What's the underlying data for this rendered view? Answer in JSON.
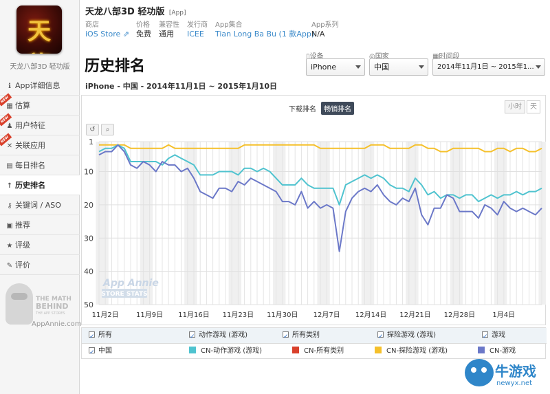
{
  "app": {
    "icon_text": "天龍",
    "subname": "天龙八部3D 轻功版",
    "title": "天龙八部3D 轻功版",
    "tag": "[App]"
  },
  "meta": [
    {
      "key": "商店",
      "value": "iOS Store  ⇗"
    },
    {
      "key": "价格",
      "value": "免费"
    },
    {
      "key": "兼容性",
      "value": "通用"
    },
    {
      "key": "发行商",
      "value": "ICEE"
    },
    {
      "key": "App集合",
      "value": "Tian Long Ba Bu (1 款App)"
    },
    {
      "key": "App系列",
      "value": "N/A"
    }
  ],
  "sidebar": {
    "items": [
      {
        "icon": "info-icon",
        "glyph": "ℹ",
        "label": "App详细信息",
        "badge": ""
      },
      {
        "icon": "calculator-icon",
        "glyph": "▦",
        "label": "估算",
        "badge": "NEW"
      },
      {
        "icon": "user-icon",
        "glyph": "♟",
        "label": "用户特征",
        "badge": "NEW"
      },
      {
        "icon": "link-icon",
        "glyph": "✕",
        "label": "关联应用",
        "badge": "NEW"
      },
      {
        "icon": "calendar-icon",
        "glyph": "▤",
        "label": "每日排名",
        "badge": ""
      },
      {
        "icon": "arrow-up-icon",
        "glyph": "↑",
        "label": "历史排名",
        "badge": ""
      },
      {
        "icon": "key-icon",
        "glyph": "⚷",
        "label": "关键词 / ASO",
        "badge": ""
      },
      {
        "icon": "feature-icon",
        "glyph": "▣",
        "label": "推荐",
        "badge": ""
      },
      {
        "icon": "star-icon",
        "glyph": "★",
        "label": "评级",
        "badge": ""
      },
      {
        "icon": "comment-icon",
        "glyph": "✎",
        "label": "评价",
        "badge": ""
      }
    ],
    "active_index": 5,
    "promo": {
      "line1": "THE MATH",
      "line2": "BEHIND",
      "line3": "THE APP STORES",
      "url": "AppAnnie.com"
    }
  },
  "page": {
    "title": "历史排名",
    "subtitle": "iPhone - 中国 - 2014年11月1日 ~ 2015年1月10日"
  },
  "filters": {
    "device": {
      "label": "设备",
      "value": "iPhone"
    },
    "country": {
      "label": "国家",
      "value": "中国"
    },
    "period": {
      "label": "时间段",
      "value": "2014年11月1日 ~ 2015年1..."
    }
  },
  "chart_controls": {
    "tab_download": "下载排名",
    "tab_grossing": "畅销排名",
    "active_tab": "畅销排名",
    "hour": "小时",
    "day": "天",
    "reset_icon": "↺",
    "zoom_icon": "⌕"
  },
  "watermark": {
    "line1": "App Annie",
    "line2": "STORE STATS"
  },
  "legend": {
    "filters": [
      "所有",
      "动作游戏 (游戏)",
      "所有类别",
      "探险游戏 (游戏)",
      "游戏"
    ],
    "country": "中国",
    "series_labels": [
      "CN-动作游戏 (游戏)",
      "CN-所有类别",
      "CN-探险游戏 (游戏)",
      "CN-游戏"
    ]
  },
  "site_watermark": {
    "line1": "牛游戏",
    "line2": "newyx.net"
  },
  "colors": {
    "action": "#4fc3cf",
    "all": "#d9402b",
    "adventure": "#f5c02a",
    "games": "#6b78c8",
    "weekend_band": "#f0f0f0"
  },
  "chart_data": {
    "type": "line",
    "y_inverted": true,
    "ylim": [
      1,
      50
    ],
    "yticks": [
      1,
      10,
      20,
      30,
      40,
      50
    ],
    "grid": true,
    "x": [
      "2014-11-01",
      "2014-11-02",
      "2014-11-03",
      "2014-11-04",
      "2014-11-05",
      "2014-11-06",
      "2014-11-07",
      "2014-11-08",
      "2014-11-09",
      "2014-11-10",
      "2014-11-11",
      "2014-11-12",
      "2014-11-13",
      "2014-11-14",
      "2014-11-15",
      "2014-11-16",
      "2014-11-17",
      "2014-11-18",
      "2014-11-19",
      "2014-11-20",
      "2014-11-21",
      "2014-11-22",
      "2014-11-23",
      "2014-11-24",
      "2014-11-25",
      "2014-11-26",
      "2014-11-27",
      "2014-11-28",
      "2014-11-29",
      "2014-11-30",
      "2014-12-01",
      "2014-12-02",
      "2014-12-03",
      "2014-12-04",
      "2014-12-05",
      "2014-12-06",
      "2014-12-07",
      "2014-12-08",
      "2014-12-09",
      "2014-12-10",
      "2014-12-11",
      "2014-12-12",
      "2014-12-13",
      "2014-12-14",
      "2014-12-15",
      "2014-12-16",
      "2014-12-17",
      "2014-12-18",
      "2014-12-19",
      "2014-12-20",
      "2014-12-21",
      "2014-12-22",
      "2014-12-23",
      "2014-12-24",
      "2014-12-25",
      "2014-12-26",
      "2014-12-27",
      "2014-12-28",
      "2014-12-29",
      "2014-12-30",
      "2014-12-31",
      "2015-01-01",
      "2015-01-02",
      "2015-01-03",
      "2015-01-04",
      "2015-01-05",
      "2015-01-06",
      "2015-01-07",
      "2015-01-08",
      "2015-01-09",
      "2015-01-10"
    ],
    "xtick_labels": [
      {
        "date": "2014-11-02",
        "label": "11月2日"
      },
      {
        "date": "2014-11-09",
        "label": "11月9日"
      },
      {
        "date": "2014-11-16",
        "label": "11月16日"
      },
      {
        "date": "2014-11-23",
        "label": "11月23日"
      },
      {
        "date": "2014-11-30",
        "label": "11月30日"
      },
      {
        "date": "2014-12-07",
        "label": "12月7日"
      },
      {
        "date": "2014-12-14",
        "label": "12月14日"
      },
      {
        "date": "2014-12-21",
        "label": "12月21日"
      },
      {
        "date": "2014-12-28",
        "label": "12月28日"
      },
      {
        "date": "2015-01-04",
        "label": "1月4日"
      }
    ],
    "series": [
      {
        "name": "CN-探险游戏 (游戏)",
        "color": "#f5c02a",
        "values": [
          2,
          2,
          2,
          2,
          2,
          3,
          3,
          3,
          3,
          3,
          3,
          2,
          3,
          3,
          3,
          3,
          3,
          3,
          3,
          3,
          3,
          3,
          3,
          2,
          2,
          2,
          2,
          2,
          2,
          2,
          2,
          2,
          2,
          2,
          2,
          3,
          3,
          3,
          3,
          3,
          3,
          3,
          3,
          2,
          2,
          2,
          3,
          3,
          3,
          3,
          2,
          2,
          3,
          3,
          4,
          4,
          3,
          3,
          3,
          3,
          3,
          4,
          4,
          3,
          3,
          4,
          3,
          3,
          4,
          4,
          3
        ]
      },
      {
        "name": "CN-动作游戏 (游戏)",
        "color": "#4fc3cf",
        "values": [
          4,
          3,
          3,
          2,
          3,
          7,
          7,
          7,
          7,
          7,
          8,
          6,
          5,
          6,
          7,
          8,
          11,
          11,
          11,
          10,
          10,
          10,
          11,
          9,
          9,
          10,
          9,
          10,
          12,
          14,
          14,
          14,
          12,
          14,
          15,
          15,
          15,
          15,
          20,
          14,
          13,
          12,
          11,
          12,
          11,
          12,
          14,
          15,
          15,
          16,
          12,
          14,
          17,
          16,
          18,
          17,
          17,
          18,
          17,
          17,
          19,
          18,
          17,
          18,
          17,
          17,
          16,
          17,
          16,
          16,
          15
        ]
      },
      {
        "name": "CN-游戏",
        "color": "#6b78c8",
        "values": [
          5,
          4,
          4,
          2,
          4,
          8,
          9,
          7,
          8,
          10,
          7,
          8,
          8,
          10,
          9,
          12,
          16,
          17,
          18,
          15,
          15,
          16,
          13,
          14,
          12,
          13,
          14,
          15,
          16,
          19,
          19,
          20,
          16,
          21,
          19,
          21,
          20,
          21,
          34,
          22,
          18,
          16,
          15,
          16,
          14,
          17,
          19,
          20,
          18,
          19,
          15,
          23,
          26,
          21,
          21,
          17,
          18,
          22,
          22,
          22,
          24,
          20,
          21,
          23,
          19,
          21,
          22,
          21,
          22,
          23,
          21
        ]
      }
    ]
  }
}
